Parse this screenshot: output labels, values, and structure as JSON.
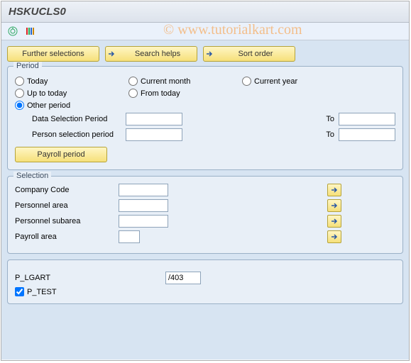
{
  "title": "HSKUCLS0",
  "watermark": "© www.tutorialkart.com",
  "toolbar": {
    "further_selections": "Further selections",
    "search_helps": "Search helps",
    "sort_order": "Sort order"
  },
  "period": {
    "legend": "Period",
    "radios": {
      "today": "Today",
      "current_month": "Current month",
      "current_year": "Current year",
      "up_to_today": "Up to today",
      "from_today": "From today",
      "other_period": "Other period"
    },
    "data_sel_label": "Data Selection Period",
    "person_sel_label": "Person selection period",
    "to_label": "To",
    "payroll_period_btn": "Payroll period",
    "data_from": "",
    "data_to": "",
    "person_from": "",
    "person_to": ""
  },
  "selection": {
    "legend": "Selection",
    "company_code_lbl": "Company Code",
    "personnel_area_lbl": "Personnel area",
    "personnel_subarea_lbl": "Personnel subarea",
    "payroll_area_lbl": "Payroll area",
    "company_code": "",
    "personnel_area": "",
    "personnel_subarea": "",
    "payroll_area": ""
  },
  "params": {
    "p_lgart_lbl": "P_LGART",
    "p_lgart": "/403",
    "p_test_lbl": "P_TEST"
  }
}
